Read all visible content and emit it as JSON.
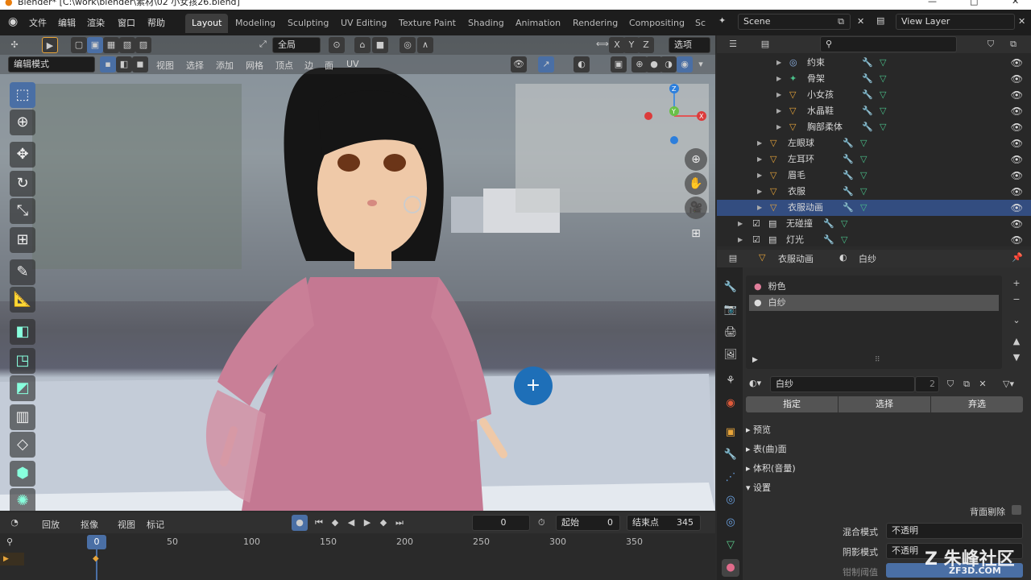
{
  "window": {
    "title": "Blender* [C:\\work\\blender\\素材\\02 小女孩26.blend]",
    "controls": [
      "—",
      "□",
      "✕"
    ]
  },
  "menu": [
    "文件",
    "编辑",
    "渲染",
    "窗口",
    "帮助"
  ],
  "workspaces": [
    "Layout",
    "Modeling",
    "Sculpting",
    "UV Editing",
    "Texture Paint",
    "Shading",
    "Animation",
    "Rendering",
    "Compositing",
    "Sc"
  ],
  "scene": {
    "label": "Scene",
    "view_layer": "View Layer"
  },
  "viewport": {
    "mode": "编辑模式",
    "menus": [
      "视图",
      "选择",
      "添加",
      "网格",
      "顶点",
      "边",
      "面",
      "UV"
    ],
    "transform": "全局",
    "options": "选项",
    "axes": [
      "X",
      "Y",
      "Z"
    ]
  },
  "outliner": {
    "rows": [
      {
        "name": "约束",
        "indent": 5
      },
      {
        "name": "骨架",
        "indent": 5
      },
      {
        "name": "小女孩",
        "indent": 5
      },
      {
        "name": "水晶鞋",
        "indent": 5
      },
      {
        "name": "胸部柔体",
        "indent": 5
      },
      {
        "name": "左眼球",
        "indent": 3
      },
      {
        "name": "左耳环",
        "indent": 3
      },
      {
        "name": "眉毛",
        "indent": 3
      },
      {
        "name": "衣服",
        "indent": 3
      },
      {
        "name": "衣服动画",
        "indent": 3,
        "selected": true
      },
      {
        "name": "无碰撞",
        "indent": 1
      },
      {
        "name": "灯光",
        "indent": 1
      }
    ]
  },
  "properties": {
    "object": "衣服动画",
    "material": "白纱",
    "slots": [
      "粉色",
      "白纱"
    ],
    "users": "2",
    "actions": [
      "指定",
      "选择",
      "弃选"
    ],
    "sections": [
      "预览",
      "表(曲)面",
      "体积(音量)",
      "设置"
    ],
    "backface_label": "背面剔除",
    "blend_label": "混合模式",
    "blend_value": "不透明",
    "shadow_label": "阴影模式",
    "shadow_value": "不透明",
    "clip_label": "钳制阈值"
  },
  "timeline": {
    "menus": [
      "回放",
      "抠像",
      "视图",
      "标记"
    ],
    "current": "0",
    "start_label": "起始",
    "start": "0",
    "end_label": "结束点",
    "end": "345",
    "ticks": [
      "0",
      "50",
      "100",
      "150",
      "200",
      "250",
      "300",
      "350"
    ],
    "frame_marker": "0"
  },
  "watermark": {
    "text": "朱峰社区",
    "sub": "ZF3D.COM"
  }
}
